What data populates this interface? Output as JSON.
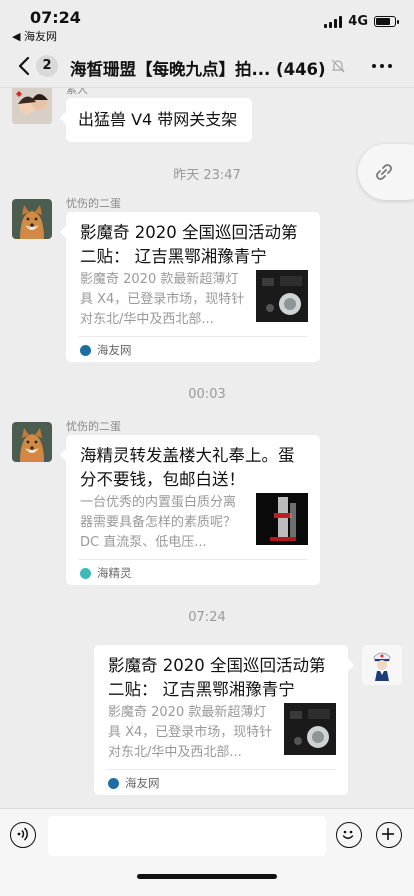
{
  "status_bar": {
    "time": "07:24",
    "back_app": "◀ 海友网",
    "network": "4G",
    "battery_level": 0.85
  },
  "nav": {
    "unread_count": "2",
    "title": "海皙珊盟【每晚九点】拍... (446)"
  },
  "messages": {
    "m1": {
      "sender": "素人",
      "text": "出猛兽 V4 带网关支架"
    },
    "ts1": "昨天 23:47",
    "m2": {
      "sender": "忧伤的二蛋",
      "title": "影魔奇 2020 全国巡回活动第二贴： 辽吉黑鄂湘豫青宁",
      "desc": "影魔奇 2020 款最新超薄灯具 X4，已登录市场，现特针对东北/华中及西北部...",
      "source": "海友网",
      "source_color": "#1d6fa3"
    },
    "ts2": "00:03",
    "m3": {
      "sender": "忧伤的二蛋",
      "title": "海精灵转发盖楼大礼奉上。蛋分不要钱，包邮白送！",
      "desc": "一台优秀的内置蛋白质分离器需要具备怎样的素质呢？DC 直流泵、低电压...",
      "source": "海精灵",
      "source_color": "#3fb9b5"
    },
    "ts3": "07:24",
    "m4": {
      "title": "影魔奇 2020 全国巡回活动第二贴： 辽吉黑鄂湘豫青宁",
      "desc": "影魔奇 2020 款最新超薄灯具 X4，已登录市场，现特针对东北/华中及西北部...",
      "source": "海友网",
      "source_color": "#1d6fa3"
    }
  },
  "input": {
    "value": "",
    "placeholder": ""
  },
  "icons": {
    "back": "chevron-left-icon",
    "mute": "bell-slash-icon",
    "more": "ellipsis-icon",
    "link": "link-icon",
    "voice": "voice-icon",
    "emoji": "smiley-icon",
    "plus": "plus-icon"
  }
}
